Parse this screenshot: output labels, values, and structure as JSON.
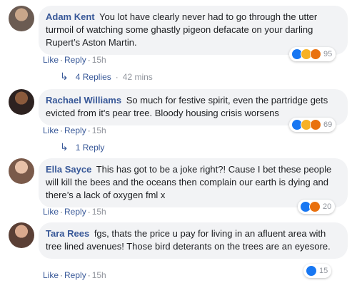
{
  "comments": [
    {
      "author": "Adam Kent",
      "text": "You lot have clearly never had to go through the utter turmoil of watching some ghastly pigeon defacate on your darling Rupert’s Aston Martin.",
      "like": "Like",
      "reply": "Reply",
      "time": "15h",
      "reaction_count": "95",
      "reactions": [
        "like-icon",
        "haha-icon",
        "angry-icon"
      ],
      "replies_label": "4 Replies",
      "replies_time": "42 mins"
    },
    {
      "author": "Rachael Williams",
      "text": "So much for festive spirit, even the partridge gets evicted from it's pear tree. Bloody housing crisis worsens",
      "like": "Like",
      "reply": "Reply",
      "time": "15h",
      "reaction_count": "69",
      "reactions": [
        "like-icon",
        "haha-icon",
        "angry-icon"
      ],
      "replies_label": "1 Reply"
    },
    {
      "author": "Ella Sayce",
      "text": "This has got to be a joke right?! Cause I bet these people will kill the bees and the oceans then complain our earth is dying and there’s a lack of oxygen fml x",
      "like": "Like",
      "reply": "Reply",
      "time": "15h",
      "reaction_count": "20",
      "reactions": [
        "like-icon",
        "angry-icon"
      ]
    },
    {
      "author": "Tara Rees",
      "text": "fgs, thats the price u pay for living in an afluent area with tree lined avenues! Those bird deterants on the trees are an eyesore.",
      "like": "Like",
      "reply": "Reply",
      "time": "15h",
      "reaction_count": "15",
      "reactions": [
        "like-icon"
      ]
    }
  ],
  "colors": {
    "link": "#385898",
    "bubble": "#f2f3f5",
    "like": "#1877f2",
    "haha": "#f7b125",
    "angry": "#e9710f"
  }
}
